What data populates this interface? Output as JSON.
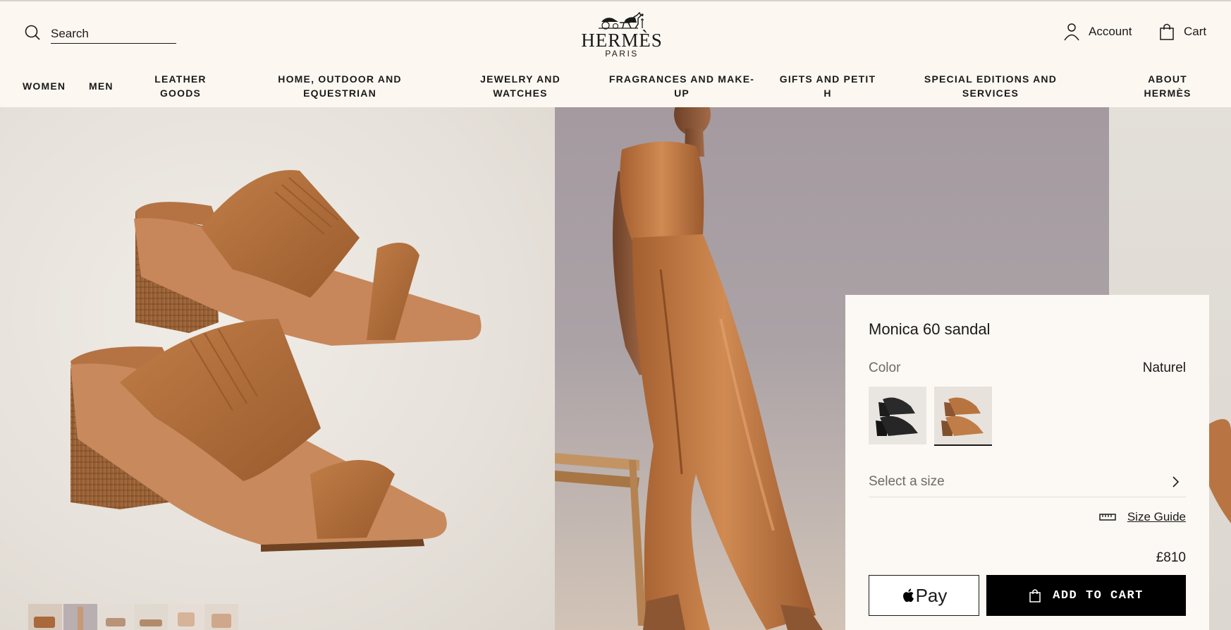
{
  "header": {
    "search_placeholder": "Search",
    "logo_word": "HERMÈS",
    "logo_sub": "PARIS",
    "account_label": "Account",
    "cart_label": "Cart"
  },
  "nav": [
    {
      "line1": "WOMEN",
      "line2": ""
    },
    {
      "line1": "MEN",
      "line2": ""
    },
    {
      "line1": "LEATHER",
      "line2": "GOODS"
    },
    {
      "line1": "HOME, OUTDOOR AND",
      "line2": "EQUESTRIAN"
    },
    {
      "line1": "JEWELRY AND",
      "line2": "WATCHES"
    },
    {
      "line1": "FRAGRANCES AND MAKE-",
      "line2": "UP"
    },
    {
      "line1": "GIFTS AND PETIT",
      "line2": "H"
    },
    {
      "line1": "SPECIAL EDITIONS AND",
      "line2": "SERVICES"
    },
    {
      "line1": "ABOUT",
      "line2": "HERMÈS"
    }
  ],
  "product": {
    "title": "Monica 60 sandal",
    "color_label": "Color",
    "color_value": "Naturel",
    "swatches": [
      "Black",
      "Naturel"
    ],
    "selected_swatch": "Naturel",
    "size_placeholder": "Select a size",
    "size_guide_label": "Size Guide",
    "price": "£810",
    "apple_pay_label": "Pay",
    "add_to_cart_label": "ADD TO CART"
  },
  "colors": {
    "background": "#fcf7f1",
    "leather": "#b06e3c",
    "button_black": "#000000"
  },
  "thumbnails_count": 6
}
